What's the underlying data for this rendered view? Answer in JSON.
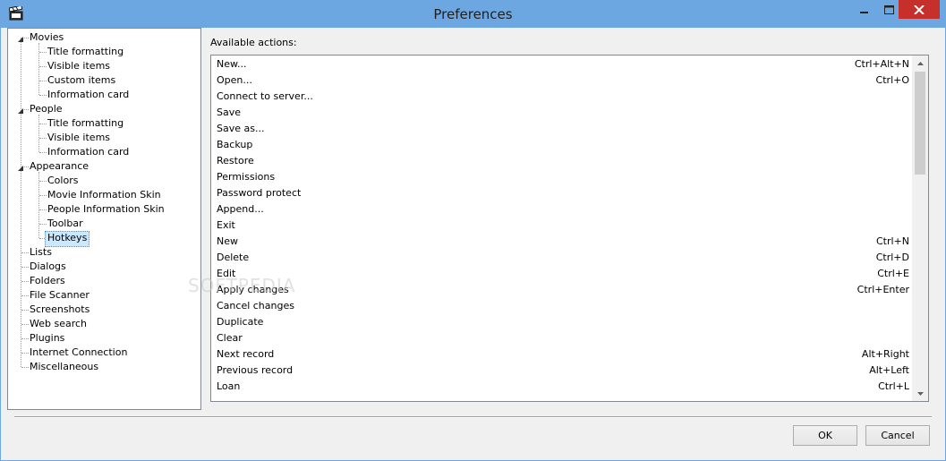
{
  "window": {
    "title": "Preferences",
    "app_icon": "clapperboard-icon"
  },
  "tree": {
    "nodes": [
      {
        "label": "Movies",
        "level": 0,
        "expanded": true
      },
      {
        "label": "Title formatting",
        "level": 1
      },
      {
        "label": "Visible items",
        "level": 1
      },
      {
        "label": "Custom items",
        "level": 1
      },
      {
        "label": "Information card",
        "level": 1
      },
      {
        "label": "People",
        "level": 0,
        "expanded": true
      },
      {
        "label": "Title formatting",
        "level": 1
      },
      {
        "label": "Visible items",
        "level": 1
      },
      {
        "label": "Information card",
        "level": 1
      },
      {
        "label": "Appearance",
        "level": 0,
        "expanded": true
      },
      {
        "label": "Colors",
        "level": 1
      },
      {
        "label": "Movie Information Skin",
        "level": 1
      },
      {
        "label": "People Information Skin",
        "level": 1
      },
      {
        "label": "Toolbar",
        "level": 1
      },
      {
        "label": "Hotkeys",
        "level": 1,
        "selected": true
      },
      {
        "label": "Lists",
        "level": 0
      },
      {
        "label": "Dialogs",
        "level": 0
      },
      {
        "label": "Folders",
        "level": 0
      },
      {
        "label": "File Scanner",
        "level": 0
      },
      {
        "label": "Screenshots",
        "level": 0
      },
      {
        "label": "Web search",
        "level": 0
      },
      {
        "label": "Plugins",
        "level": 0
      },
      {
        "label": "Internet Connection",
        "level": 0
      },
      {
        "label": "Miscellaneous",
        "level": 0
      }
    ]
  },
  "actions_label": "Available actions:",
  "actions": [
    {
      "action": "New...",
      "key": "Ctrl+Alt+N"
    },
    {
      "action": "Open...",
      "key": "Ctrl+O"
    },
    {
      "action": "Connect to server...",
      "key": ""
    },
    {
      "action": "Save",
      "key": ""
    },
    {
      "action": "Save as...",
      "key": ""
    },
    {
      "action": "Backup",
      "key": ""
    },
    {
      "action": "Restore",
      "key": ""
    },
    {
      "action": "Permissions",
      "key": ""
    },
    {
      "action": "Password protect",
      "key": ""
    },
    {
      "action": "Append...",
      "key": ""
    },
    {
      "action": "Exit",
      "key": ""
    },
    {
      "action": "New",
      "key": "Ctrl+N"
    },
    {
      "action": "Delete",
      "key": "Ctrl+D"
    },
    {
      "action": "Edit",
      "key": "Ctrl+E"
    },
    {
      "action": "Apply changes",
      "key": "Ctrl+Enter"
    },
    {
      "action": "Cancel changes",
      "key": ""
    },
    {
      "action": "Duplicate",
      "key": ""
    },
    {
      "action": "Clear",
      "key": ""
    },
    {
      "action": "Next record",
      "key": "Alt+Right"
    },
    {
      "action": "Previous record",
      "key": "Alt+Left"
    },
    {
      "action": "Loan",
      "key": "Ctrl+L"
    }
  ],
  "buttons": {
    "ok": "OK",
    "cancel": "Cancel"
  },
  "watermark": "SOFTPEDIA",
  "colors": {
    "titlebar": "#6da7e1",
    "close_button": "#c7302a",
    "selection": "#cce8ff"
  }
}
